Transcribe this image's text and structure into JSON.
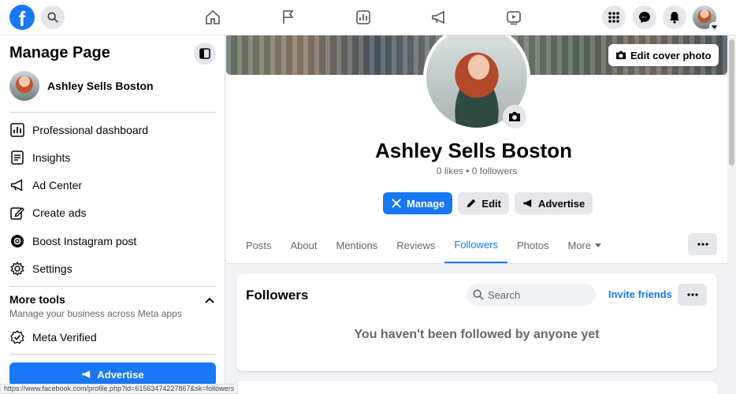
{
  "nav": {
    "logo": "f",
    "icons": [
      "search-icon",
      "home-icon",
      "flag-icon",
      "insights-icon",
      "megaphone-icon",
      "video-icon",
      "apps-grid-icon",
      "messenger-icon",
      "bell-icon"
    ]
  },
  "sidebar": {
    "title": "Manage Page",
    "profile_name": "Ashley Sells Boston",
    "items": [
      {
        "label": "Professional dashboard",
        "icon": "dashboard-icon"
      },
      {
        "label": "Insights",
        "icon": "insights-icon"
      },
      {
        "label": "Ad Center",
        "icon": "megaphone-icon"
      },
      {
        "label": "Create ads",
        "icon": "edit-icon"
      },
      {
        "label": "Boost Instagram post",
        "icon": "instagram-icon"
      },
      {
        "label": "Settings",
        "icon": "gear-icon"
      }
    ],
    "more_tools": {
      "title": "More tools",
      "subtitle": "Manage your business across Meta apps",
      "items": [
        {
          "label": "Meta Verified",
          "icon": "verified-icon"
        }
      ]
    },
    "advertise_label": "Advertise"
  },
  "main": {
    "edit_cover_label": "Edit cover photo",
    "page_name": "Ashley Sells Boston",
    "stats": "0 likes • 0 followers",
    "actions": {
      "manage": "Manage",
      "edit": "Edit",
      "advertise": "Advertise"
    },
    "tabs": [
      "Posts",
      "About",
      "Mentions",
      "Reviews",
      "Followers",
      "Photos",
      "More"
    ],
    "active_tab": "Followers",
    "followers": {
      "title": "Followers",
      "search_placeholder": "Search",
      "invite_label": "Invite friends",
      "empty_message": "You haven't been followed by anyone yet"
    }
  },
  "status_url": "https://www.facebook.com/profile.php?id=61563474227867&sk=followers",
  "colors": {
    "accent": "#1877f2",
    "text_secondary": "#65676b",
    "button_gray": "#e4e6eb"
  }
}
